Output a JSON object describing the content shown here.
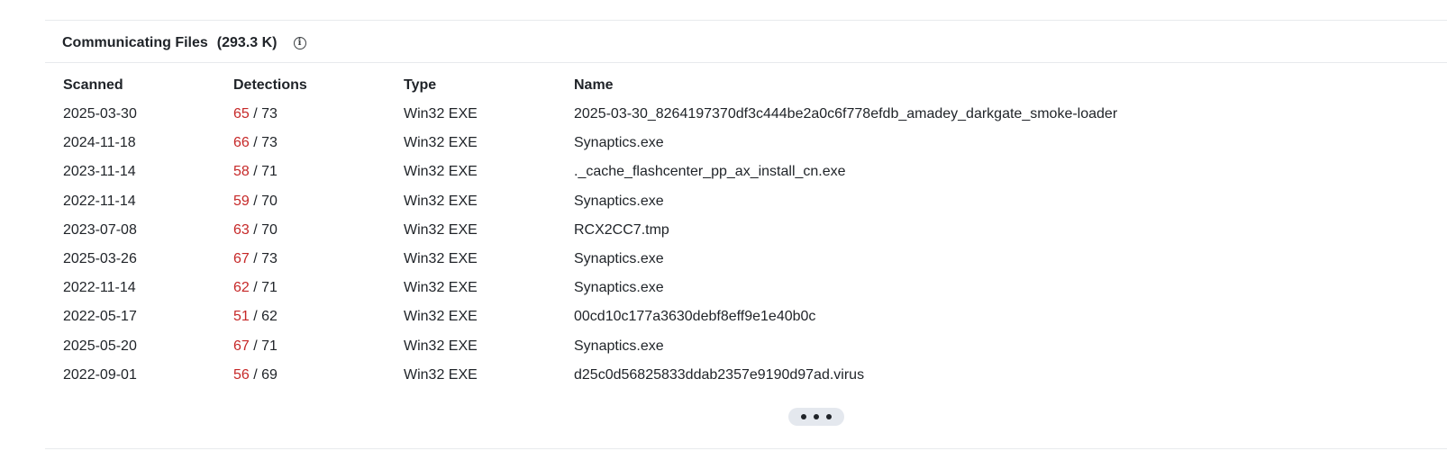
{
  "section": {
    "title": "Communicating Files",
    "count": "(293.3 K)",
    "info_icon": "info-circle-icon"
  },
  "columns": {
    "scanned": "Scanned",
    "detections": "Detections",
    "type": "Type",
    "name": "Name"
  },
  "rows": [
    {
      "scanned": "2025-03-30",
      "positives": "65",
      "total": "/ 73",
      "type": "Win32 EXE",
      "name": "2025-03-30_8264197370df3c444be2a0c6f778efdb_amadey_darkgate_smoke-loader"
    },
    {
      "scanned": "2024-11-18",
      "positives": "66",
      "total": "/ 73",
      "type": "Win32 EXE",
      "name": "Synaptics.exe"
    },
    {
      "scanned": "2023-11-14",
      "positives": "58",
      "total": "/ 71",
      "type": "Win32 EXE",
      "name": "._cache_flashcenter_pp_ax_install_cn.exe"
    },
    {
      "scanned": "2022-11-14",
      "positives": "59",
      "total": "/ 70",
      "type": "Win32 EXE",
      "name": "Synaptics.exe"
    },
    {
      "scanned": "2023-07-08",
      "positives": "63",
      "total": "/ 70",
      "type": "Win32 EXE",
      "name": "RCX2CC7.tmp"
    },
    {
      "scanned": "2025-03-26",
      "positives": "67",
      "total": "/ 73",
      "type": "Win32 EXE",
      "name": "Synaptics.exe"
    },
    {
      "scanned": "2022-11-14",
      "positives": "62",
      "total": "/ 71",
      "type": "Win32 EXE",
      "name": "Synaptics.exe"
    },
    {
      "scanned": "2022-05-17",
      "positives": "51",
      "total": "/ 62",
      "type": "Win32 EXE",
      "name": "00cd10c177a3630debf8eff9e1e40b0c"
    },
    {
      "scanned": "2025-05-20",
      "positives": "67",
      "total": "/ 71",
      "type": "Win32 EXE",
      "name": "Synaptics.exe"
    },
    {
      "scanned": "2022-09-01",
      "positives": "56",
      "total": "/ 69",
      "type": "Win32 EXE",
      "name": "d25c0d56825833ddab2357e9190d97ad.virus"
    }
  ],
  "more_button": {
    "icon": "ellipsis-icon"
  },
  "colors": {
    "detection_positive": "#c62828",
    "divider": "#e8eaed",
    "more_button_bg": "#e4e8ee"
  }
}
